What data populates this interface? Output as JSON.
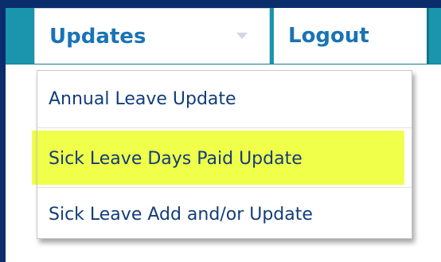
{
  "nav": {
    "tabs": [
      {
        "label": "Updates",
        "icon": "caret-down-icon"
      },
      {
        "label": "Logout"
      }
    ]
  },
  "dropdown": {
    "items": [
      {
        "label": "Annual Leave Update"
      },
      {
        "label": "Sick Leave Days Paid Update",
        "highlighted": true
      },
      {
        "label": "Sick Leave Add and/or Update"
      }
    ]
  },
  "colors": {
    "nav_bar": "#1b95ad",
    "frame": "#0b2d6b",
    "tab_text": "#1a73b5",
    "menu_text": "#123d7a",
    "highlight": "#f0ff4a"
  }
}
